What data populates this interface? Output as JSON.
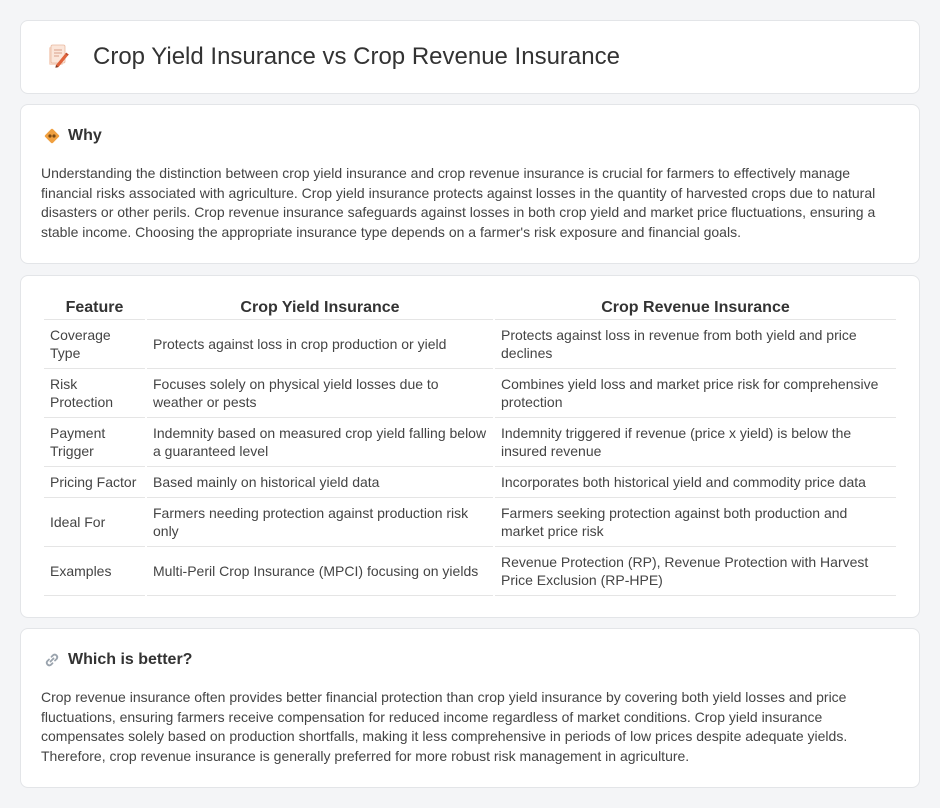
{
  "header": {
    "icon": "pencil-paper-icon",
    "title": "Crop Yield Insurance vs Crop Revenue Insurance"
  },
  "why": {
    "icon": "diamond-sign-icon",
    "title": "Why",
    "body": "Understanding the distinction between crop yield insurance and crop revenue insurance is crucial for farmers to effectively manage financial risks associated with agriculture. Crop yield insurance protects against losses in the quantity of harvested crops due to natural disasters or other perils. Crop revenue insurance safeguards against losses in both crop yield and market price fluctuations, ensuring a stable income. Choosing the appropriate insurance type depends on a farmer's risk exposure and financial goals."
  },
  "table": {
    "headers": [
      "Feature",
      "Crop Yield Insurance",
      "Crop Revenue Insurance"
    ],
    "rows": [
      [
        "Coverage Type",
        "Protects against loss in crop production or yield",
        "Protects against loss in revenue from both yield and price declines"
      ],
      [
        "Risk Protection",
        "Focuses solely on physical yield losses due to weather or pests",
        "Combines yield loss and market price risk for comprehensive protection"
      ],
      [
        "Payment Trigger",
        "Indemnity based on measured crop yield falling below a guaranteed level",
        "Indemnity triggered if revenue (price x yield) is below the insured revenue"
      ],
      [
        "Pricing Factor",
        "Based mainly on historical yield data",
        "Incorporates both historical yield and commodity price data"
      ],
      [
        "Ideal For",
        "Farmers needing protection against production risk only",
        "Farmers seeking protection against both production and market price risk"
      ],
      [
        "Examples",
        "Multi-Peril Crop Insurance (MPCI) focusing on yields",
        "Revenue Protection (RP), Revenue Protection with Harvest Price Exclusion (RP-HPE)"
      ]
    ]
  },
  "better": {
    "icon": "link-icon",
    "title": "Which is better?",
    "body": "Crop revenue insurance often provides better financial protection than crop yield insurance by covering both yield losses and price fluctuations, ensuring farmers receive compensation for reduced income regardless of market conditions. Crop yield insurance compensates solely based on production shortfalls, making it less comprehensive in periods of low prices despite adequate yields. Therefore, crop revenue insurance is generally preferred for more robust risk management in agriculture."
  },
  "colors": {
    "page_bg": "#f4f5f7",
    "card_border": "#e3e5e8",
    "icon_orange": "#f0a040",
    "icon_pink": "#e06b6b"
  }
}
